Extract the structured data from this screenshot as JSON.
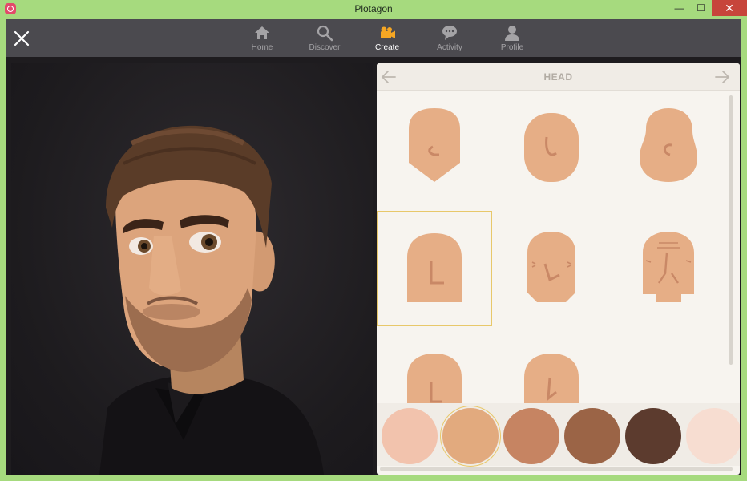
{
  "window": {
    "title": "Plotagon",
    "minimize_glyph": "—",
    "maximize_glyph": "☐",
    "close_glyph": "✕"
  },
  "nav": {
    "items": [
      {
        "label": "Home",
        "icon": "home-icon"
      },
      {
        "label": "Discover",
        "icon": "search-icon"
      },
      {
        "label": "Create",
        "icon": "camera-icon",
        "active": true
      },
      {
        "label": "Activity",
        "icon": "chat-icon"
      },
      {
        "label": "Profile",
        "icon": "profile-icon"
      }
    ]
  },
  "panel": {
    "title": "HEAD",
    "head_shapes_count_visible": 8,
    "selected_head_index": 3
  },
  "skin_tones": {
    "colors": [
      "#f2c3ad",
      "#e2aa7e",
      "#c68462",
      "#9b6446",
      "#5c3b2e",
      "#f7ddd1"
    ],
    "selected_index": 1
  },
  "colors": {
    "window_frame": "#a6da7e",
    "nav_bar": "#4b4a4f",
    "accent_active": "#f5a623",
    "selection": "#e8c86a",
    "head_fill": "#e6ae86"
  }
}
